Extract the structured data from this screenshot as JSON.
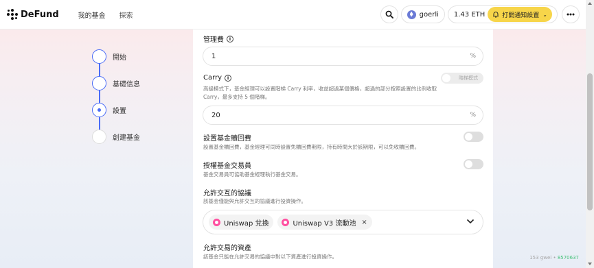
{
  "header": {
    "brand": "DeFund",
    "nav": [
      "我的基金",
      "探索"
    ],
    "network": "goerli",
    "balance": "1.43 ETH",
    "notify_label": "打開通知設置"
  },
  "steps": [
    {
      "label": "開始",
      "state": "done"
    },
    {
      "label": "基礎信息",
      "state": "done"
    },
    {
      "label": "設置",
      "state": "current"
    },
    {
      "label": "創建基金",
      "state": "pending"
    }
  ],
  "form": {
    "management_fee": {
      "label": "管理費",
      "value": "1",
      "suffix": "%"
    },
    "carry": {
      "label": "Carry",
      "toggle_label": "階梯模式",
      "desc_line1": "高級模式下，基金經理可以設置階梯 Carry 利率，收益超過某個價格，超過的部分按照設置的比例收取",
      "desc_line2": "Carry，最多支持 5 個階梯。",
      "value": "20",
      "suffix": "%"
    },
    "redemption": {
      "label": "設置基金贖回費",
      "desc": "設置基金贖回費，基金經理可同時設置免贖回費期限，持有時間大於該期限，可以免收贖回費。"
    },
    "trader": {
      "label": "授權基金交易員",
      "desc": "基金交易員可協助基金經理執行基金交易。"
    },
    "protocols": {
      "label": "允許交互的協議",
      "desc": "該基金僅能與允許交互的協議進行投資操作。",
      "chips": [
        "Uniswap 兌換",
        "Uniswap V3 流動池"
      ]
    },
    "assets": {
      "label": "允許交易的資產",
      "desc": "該基金只能在允許交易的協議中對以下資產進行投資操作。"
    }
  },
  "footer": {
    "gwei": "153 gwei",
    "block": "8570637"
  },
  "colors": {
    "accent": "#4a6cf7",
    "notify_bg": "#f7d54a",
    "uniswap": "#ff4fa0",
    "block_green": "#47c27a"
  }
}
